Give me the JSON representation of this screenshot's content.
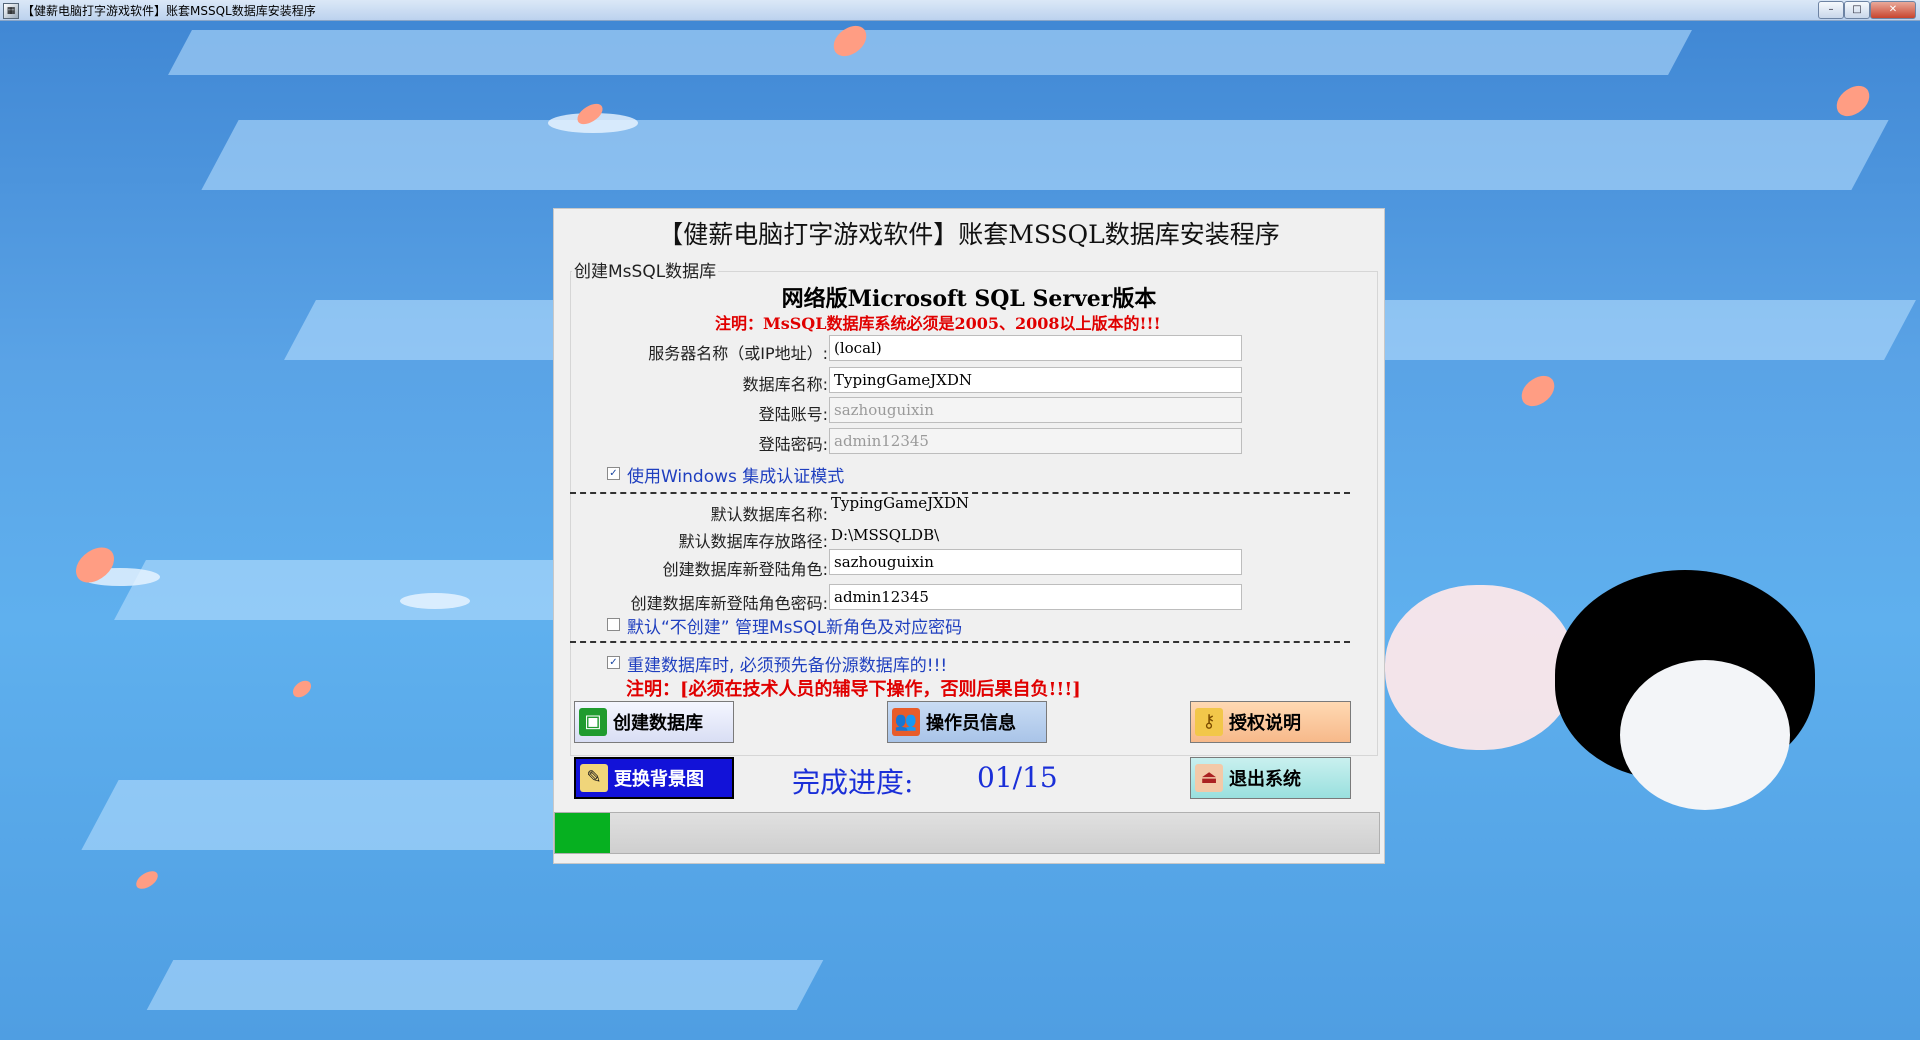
{
  "window": {
    "title": "【健薪电脑打字游戏软件】账套MSSQL数据库安装程序",
    "controls": {
      "minimize": "–",
      "maximize": "□",
      "close": "✕"
    }
  },
  "dialog": {
    "title": "【健薪电脑打字游戏软件】账套MSSQL数据库安装程序",
    "group_label": "创建MsSQL数据库",
    "version_heading": "网络版Microsoft SQL Server版本",
    "notice": "注明：MsSQL数据库系统必须是2005、2008以上版本的!!!",
    "fields": {
      "server": {
        "label": "服务器名称（或IP地址）:",
        "value": "(local)"
      },
      "database": {
        "label": "数据库名称:",
        "value": "TypingGameJXDN"
      },
      "login": {
        "label": "登陆账号:",
        "value": "sazhouguixin"
      },
      "password": {
        "label": "登陆密码:",
        "value": "admin12345"
      }
    },
    "windows_auth": {
      "label": "使用Windows 集成认证模式",
      "checked": true
    },
    "defaults": {
      "db_name": {
        "label": "默认数据库名称:",
        "value": "TypingGameJXDN"
      },
      "db_path": {
        "label": "默认数据库存放路径:",
        "value": "D:\\MSSQLDB\\"
      },
      "new_login_role": {
        "label": "创建数据库新登陆角色:",
        "value": "sazhouguixin"
      },
      "new_login_password": {
        "label": "创建数据库新登陆角色密码:",
        "value": "admin12345"
      }
    },
    "no_create_role": {
      "label": "默认“不创建”  管理MsSQL新角色及对应密码",
      "checked": false
    },
    "backup_notice": {
      "label": "重建数据库时, 必须预先备份源数据库的!!!",
      "checked": true
    },
    "warning": "注明：[必须在技术人员的辅导下操作，否则后果自负!!!]",
    "buttons": {
      "create": "创建数据库",
      "operator": "操作员信息",
      "license": "授权说明",
      "change_bg": "更换背景图",
      "exit": "退出系统"
    },
    "progress": {
      "label": "完成进度:",
      "value": "01/15",
      "fraction": 0.067
    }
  },
  "colors": {
    "accent_blue": "#1a2fd8",
    "warning_red": "#e00000",
    "progress_green": "#06b020"
  }
}
